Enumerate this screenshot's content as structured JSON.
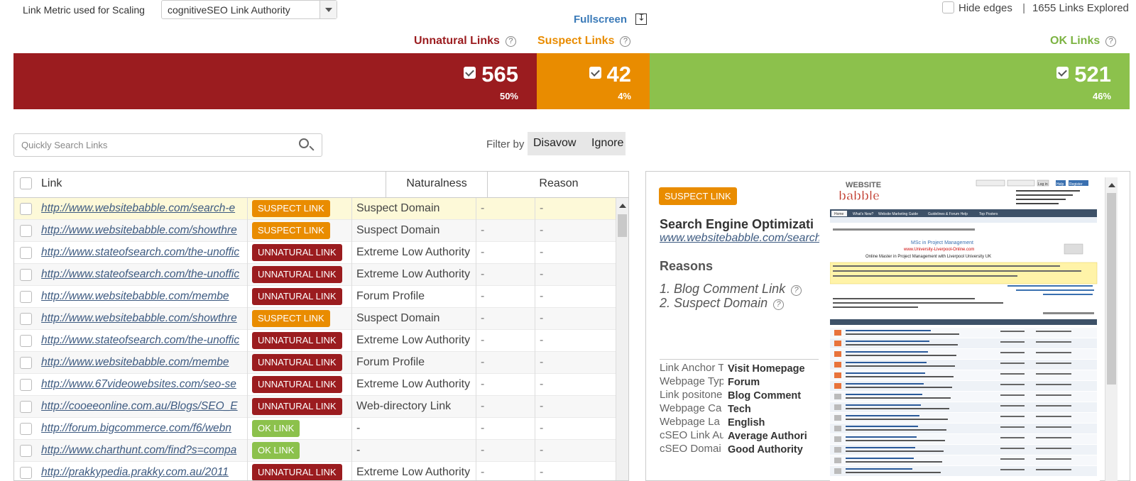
{
  "toolbar": {
    "metric_label": "Link Metric used for Scaling",
    "metric_value": "cognitiveSEO Link Authority",
    "fullscreen": "Fullscreen",
    "hide_edges": "Hide edges",
    "separator": "|",
    "links_explored": "1655 Links Explored"
  },
  "categories": {
    "unnatural": {
      "label": "Unnatural Links",
      "count": "565",
      "pct": "50%",
      "color": "#9b1c1f"
    },
    "suspect": {
      "label": "Suspect Links",
      "count": "42",
      "pct": "4%",
      "color": "#e98c00"
    },
    "ok": {
      "label": "OK Links",
      "count": "521",
      "pct": "46%",
      "color": "#8cc14c"
    }
  },
  "search": {
    "placeholder": "Quickly Search Links"
  },
  "filter": {
    "label": "Filter by",
    "disavow": "Disavow",
    "ignore": "Ignore"
  },
  "table": {
    "headers": {
      "link": "Link",
      "naturalness": "Naturalness",
      "reason": "Reason"
    },
    "rows": [
      {
        "link": "http://www.websitebabble.com/search-e",
        "badge": "SUSPECT LINK",
        "type": "suspect",
        "reason": "Suspect Domain",
        "c3": "-",
        "c4": "-",
        "highlight": true
      },
      {
        "link": "http://www.websitebabble.com/showthre",
        "badge": "SUSPECT LINK",
        "type": "suspect",
        "reason": "Suspect Domain",
        "c3": "-",
        "c4": "-"
      },
      {
        "link": "http://www.stateofsearch.com/the-unoffic",
        "badge": "UNNATURAL LINK",
        "type": "unnatural",
        "reason": "Extreme Low Authority",
        "c3": "-",
        "c4": "-"
      },
      {
        "link": "http://www.stateofsearch.com/the-unoffic",
        "badge": "UNNATURAL LINK",
        "type": "unnatural",
        "reason": "Extreme Low Authority",
        "c3": "-",
        "c4": "-"
      },
      {
        "link": "http://www.websitebabble.com/membe",
        "badge": "UNNATURAL LINK",
        "type": "unnatural",
        "reason": "Forum Profile",
        "c3": "-",
        "c4": "-"
      },
      {
        "link": "http://www.websitebabble.com/showthre",
        "badge": "SUSPECT LINK",
        "type": "suspect",
        "reason": "Suspect Domain",
        "c3": "-",
        "c4": "-"
      },
      {
        "link": "http://www.stateofsearch.com/the-unoffic",
        "badge": "UNNATURAL LINK",
        "type": "unnatural",
        "reason": "Extreme Low Authority",
        "c3": "-",
        "c4": "-"
      },
      {
        "link": "http://www.websitebabble.com/membe",
        "badge": "UNNATURAL LINK",
        "type": "unnatural",
        "reason": "Forum Profile",
        "c3": "-",
        "c4": "-"
      },
      {
        "link": "http://www.67videowebsites.com/seo-se",
        "badge": "UNNATURAL LINK",
        "type": "unnatural",
        "reason": "Extreme Low Authority",
        "c3": "-",
        "c4": "-"
      },
      {
        "link": "http://cooeeonline.com.au/Blogs/SEO_E",
        "badge": "UNNATURAL LINK",
        "type": "unnatural",
        "reason": "Web-directory Link",
        "c3": "-",
        "c4": "-"
      },
      {
        "link": "http://forum.bigcommerce.com/f6/webn",
        "badge": "OK LINK",
        "type": "ok",
        "reason": "-",
        "c3": "-",
        "c4": "-"
      },
      {
        "link": "http://www.charthunt.com/find?s=compa",
        "badge": "OK LINK",
        "type": "ok",
        "reason": "-",
        "c3": "-",
        "c4": "-"
      },
      {
        "link": "http://prakkypedia.prakky.com.au/2011",
        "badge": "UNNATURAL LINK",
        "type": "unnatural",
        "reason": "Extreme Low Authority",
        "c3": "-",
        "c4": "-"
      }
    ]
  },
  "detail": {
    "badge": "SUSPECT LINK",
    "title": "Search Engine Optimizati",
    "url": "www.websitebabble.com/search",
    "reasons_heading": "Reasons",
    "reasons": [
      "1.  Blog Comment Link",
      "2.  Suspect Domain"
    ],
    "properties": [
      {
        "key": "Link Anchor T",
        "value": "Visit Homepage"
      },
      {
        "key": "Webpage Typ",
        "value": "Forum"
      },
      {
        "key": "Link positone",
        "value": "Blog Comment"
      },
      {
        "key": "Webpage Ca",
        "value": "Tech"
      },
      {
        "key": "Webpage La",
        "value": "English"
      },
      {
        "key": "cSEO Link Au",
        "value": "Average Authori"
      },
      {
        "key": "cSEO Domai",
        "value": "Good Authority"
      }
    ]
  },
  "preview": {
    "logo_top": "WEBSITE",
    "logo_bottom": "babble",
    "nav_tabs": [
      "Home",
      "What's New?",
      "Website Marketing Guide",
      "Guidelines & Forum Help",
      "Top Posters"
    ],
    "ad_title": "MSc in Project Management",
    "ad_url": "www.University-Liverpool-Online.com",
    "ad_text": "Online Master in Project Management with Liverpool University UK",
    "login_button": "Log in",
    "help_button": "Help",
    "register_button": "Register"
  },
  "colors": {
    "unnatural": "#9b1c1f",
    "suspect": "#e98c00",
    "ok": "#8cc14c",
    "link": "#3d5a80",
    "accent": "#3a7ab8"
  }
}
